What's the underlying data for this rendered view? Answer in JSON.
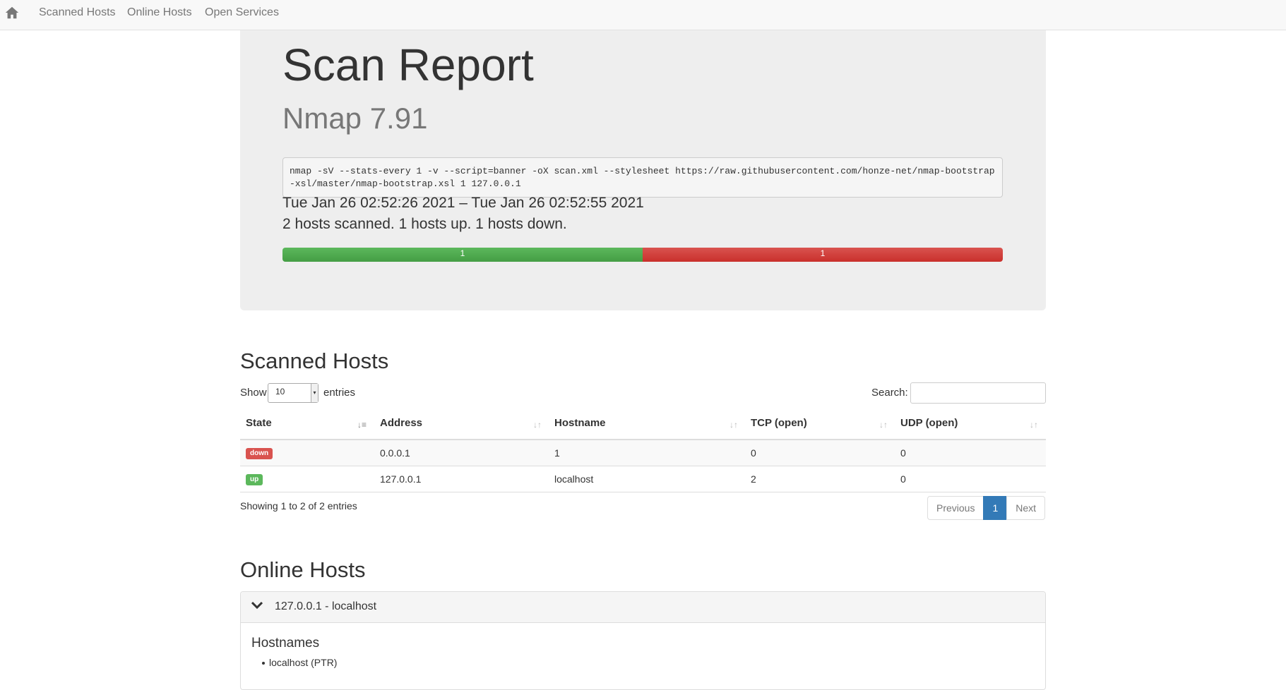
{
  "navbar": {
    "home_icon": "home-icon",
    "links": [
      "Scanned Hosts",
      "Online Hosts",
      "Open Services"
    ]
  },
  "report": {
    "title": "Scan Report",
    "subtitle": "Nmap 7.91",
    "command": "nmap -sV --stats-every 1 -v --script=banner -oX scan.xml --stylesheet https://raw.githubusercontent.com/honze-net/nmap-bootstrap-xsl/master/nmap-bootstrap.xsl 1 127.0.0.1",
    "time_range": "Tue Jan 26 02:52:26 2021 – Tue Jan 26 02:52:55 2021",
    "summary": "2 hosts scanned. 1 hosts up. 1 hosts down.",
    "progress": {
      "up_label": "1",
      "down_label": "1",
      "up_fraction": 0.5,
      "down_fraction": 0.5,
      "up_color": "#5cb85c",
      "down_color": "#d9534f"
    }
  },
  "scanned_hosts": {
    "heading": "Scanned Hosts",
    "show_label": "Show",
    "entries_value": "10",
    "entries_label": "entries",
    "search_label": "Search:",
    "columns": [
      "State",
      "Address",
      "Hostname",
      "TCP (open)",
      "UDP (open)"
    ],
    "rows": [
      {
        "state": "down",
        "address": "0.0.0.1",
        "hostname": "1",
        "tcp": "0",
        "udp": "0"
      },
      {
        "state": "up",
        "address": "127.0.0.1",
        "hostname": "localhost",
        "tcp": "2",
        "udp": "0"
      }
    ],
    "info": "Showing 1 to 2 of 2 entries",
    "pagination": {
      "previous": "Previous",
      "current": "1",
      "next": "Next"
    }
  },
  "online_hosts": {
    "heading": "Online Hosts",
    "panel_title": "127.0.0.1 - localhost",
    "section_title": "Hostnames",
    "hostnames": [
      "localhost (PTR)"
    ]
  }
}
